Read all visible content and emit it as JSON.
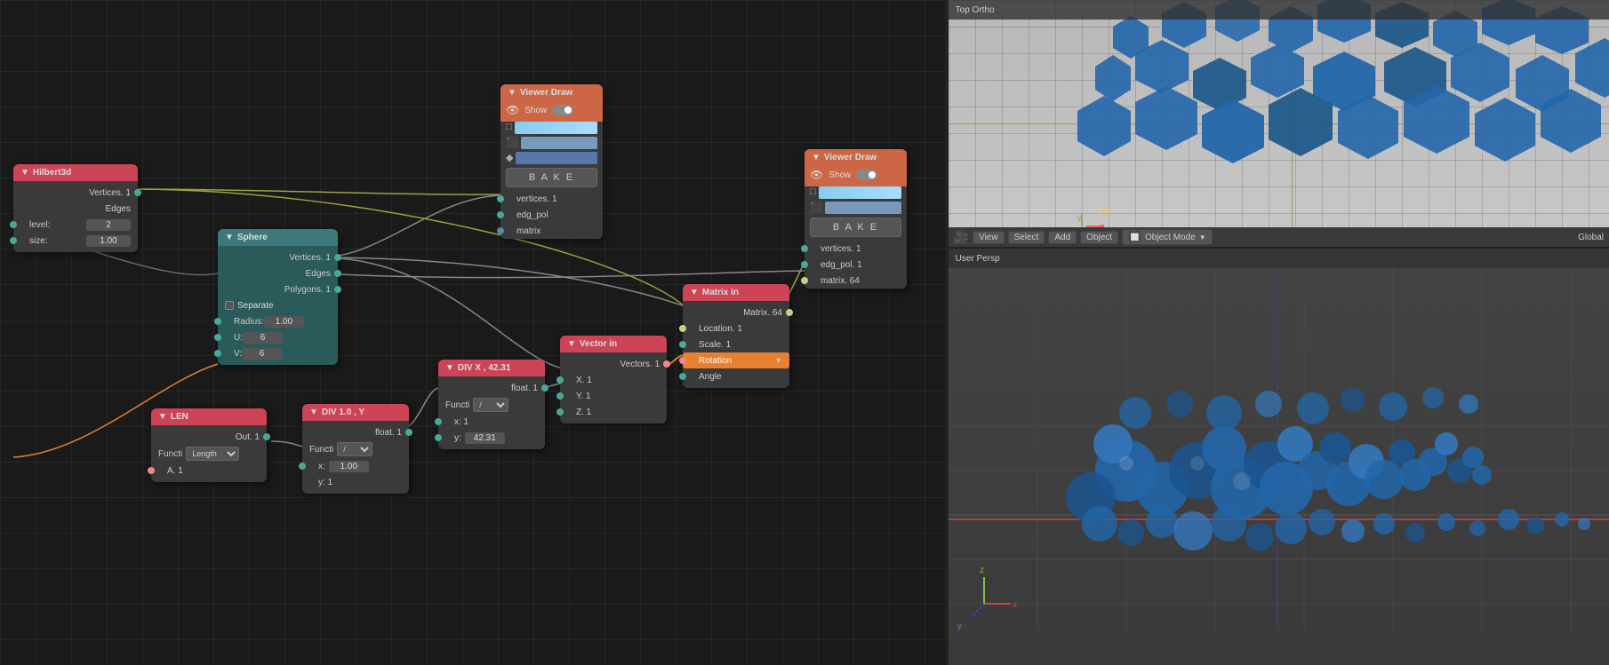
{
  "viewport_top": {
    "label": "Top Ortho",
    "toolbar_items": [
      "View",
      "Select",
      "Add",
      "Object",
      "Object Mode",
      "Global"
    ]
  },
  "viewport_bottom": {
    "label": "User Persp"
  },
  "nodes": {
    "hilbert3d": {
      "title": "Hilbert3d",
      "header_color": "#c45868",
      "outputs": [
        "Vertices. 1",
        "Edges"
      ],
      "inputs": [
        {
          "label": "level:",
          "value": "2"
        },
        {
          "label": "size:",
          "value": "1.00"
        }
      ]
    },
    "sphere": {
      "title": "Sphere",
      "outputs": [
        "Vertices. 1",
        "Edges",
        "Polygons. 1"
      ],
      "checkbox": "Separate",
      "inputs": [
        {
          "label": "Radius:",
          "value": "1.00"
        },
        {
          "label": "U:",
          "value": "6"
        },
        {
          "label": "V:",
          "value": "6"
        }
      ]
    },
    "viewer_draw_1": {
      "title": "Viewer Draw",
      "show_label": "Show",
      "bake_label": "B A K E",
      "inputs": [
        "vertices. 1",
        "edg_pol",
        "matrix"
      ]
    },
    "viewer_draw_2": {
      "title": "Viewer Draw",
      "show_label": "Show",
      "bake_label": "B A K E",
      "inputs": [
        "vertices. 1",
        "edg_pol. 1",
        "matrix. 64"
      ]
    },
    "len": {
      "title": "LEN",
      "outputs": [
        "Out. 1"
      ],
      "functi": "Length",
      "inputs": [
        "A. 1"
      ]
    },
    "div10_y": {
      "title": "DIV 1.0 , Y",
      "outputs": [
        "float. 1"
      ],
      "functi": "/",
      "inputs": [
        {
          "label": "x:",
          "value": "1.00"
        },
        {
          "label": "y: 1"
        }
      ]
    },
    "div_x": {
      "title": "DIV X , 42.31",
      "outputs": [
        "float. 1"
      ],
      "functi": "/",
      "inputs": [
        {
          "label": "x: 1"
        },
        {
          "label": "y:",
          "value": "42.31"
        }
      ]
    },
    "vector_in": {
      "title": "Vector in",
      "outputs": [
        "Vectors. 1"
      ],
      "inputs": [
        "X. 1",
        "Y. 1",
        "Z. 1"
      ]
    },
    "matrix_in": {
      "title": "Matrix in",
      "outputs": [
        "Matrix. 64"
      ],
      "inputs": [
        {
          "label": "Location. 1"
        },
        {
          "label": "Scale. 1"
        },
        {
          "label": "Rotation",
          "highlight": true
        },
        {
          "label": "Angle"
        }
      ]
    }
  }
}
